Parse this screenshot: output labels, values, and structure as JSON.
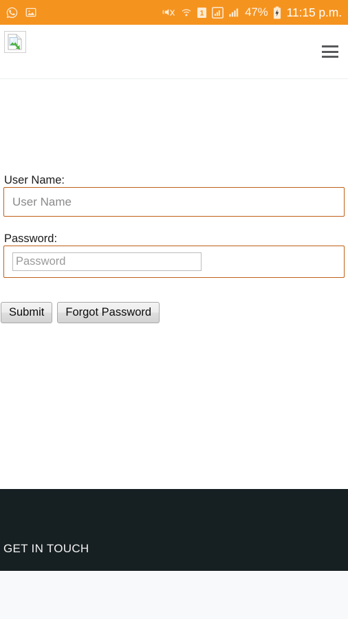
{
  "statusbar": {
    "background_color": "#F5931F",
    "left_icons": [
      {
        "name": "whatsapp-icon",
        "label": "WhatsApp"
      },
      {
        "name": "gallery-image-icon",
        "label": "Image saved"
      }
    ],
    "right_icons": [
      {
        "name": "mute-vibrate-icon",
        "label": "Ringer muted"
      },
      {
        "name": "wifi-icon",
        "label": "Wi-Fi"
      },
      {
        "name": "sim1-icon",
        "label": "1"
      },
      {
        "name": "signal-sim1-icon",
        "label": "Signal SIM 1"
      },
      {
        "name": "signal-sim2-icon",
        "label": "Signal SIM 2"
      }
    ],
    "battery_percent": "47%",
    "battery_state_icon": "battery-charging-icon",
    "clock": "11:15 p.m."
  },
  "header": {
    "logo_alt": "",
    "logo_icon": "broken-image-placeholder-icon",
    "menu_icon": "hamburger-menu-icon",
    "border_color": "#eceeef"
  },
  "form": {
    "username": {
      "label": "User Name:",
      "value": "",
      "placeholder": "User Name",
      "border_color": "#BF5F17"
    },
    "password": {
      "label": "Password:",
      "value": "",
      "placeholder": "Password",
      "border_color": "#BF5F17",
      "inner_border_color": "#bcbcbc"
    },
    "submit_label": "Submit",
    "forgot_password_label": "Forgot Password"
  },
  "footer": {
    "heading": "GET IN TOUCH",
    "background_color": "#161F21",
    "text_color": "#f2f2f2",
    "below_background_color": "#F8F9FA"
  }
}
